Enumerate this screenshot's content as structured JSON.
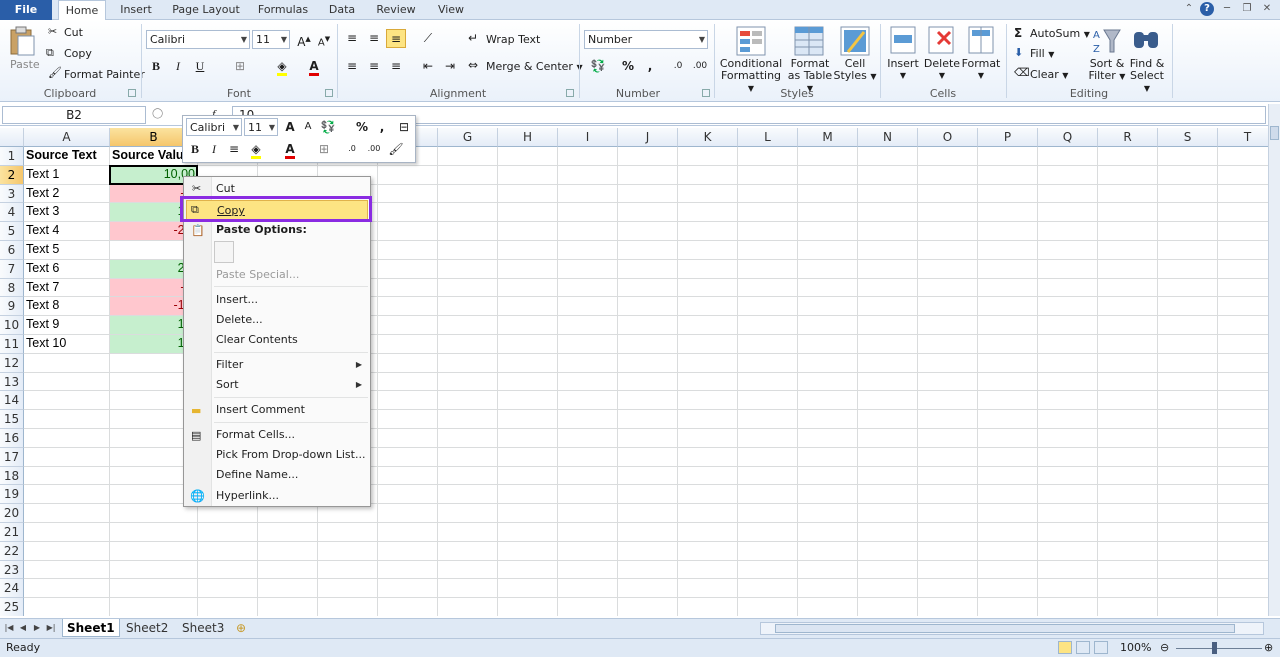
{
  "tabs": [
    "File",
    "Home",
    "Insert",
    "Page Layout",
    "Formulas",
    "Data",
    "Review",
    "View"
  ],
  "ribbon": {
    "clipboard": {
      "paste": "Paste",
      "cut": "Cut",
      "copy": "Copy",
      "format_painter": "Format Painter",
      "label": "Clipboard"
    },
    "font": {
      "name": "Calibri",
      "size": "11",
      "label": "Font"
    },
    "alignment": {
      "wrap_text": "Wrap Text",
      "merge_center": "Merge & Center",
      "label": "Alignment"
    },
    "number": {
      "format": "Number",
      "label": "Number"
    },
    "styles": {
      "conditional": [
        "Conditional",
        "Formatting"
      ],
      "format_table": [
        "Format",
        "as Table"
      ],
      "cell_styles": [
        "Cell",
        "Styles"
      ],
      "label": "Styles"
    },
    "cells": {
      "insert": "Insert",
      "delete": "Delete",
      "format": "Format",
      "label": "Cells"
    },
    "editing": {
      "autosum": "AutoSum",
      "fill": "Fill",
      "clear": "Clear",
      "sort": [
        "Sort &",
        "Filter"
      ],
      "find": [
        "Find &",
        "Select"
      ],
      "label": "Editing"
    }
  },
  "formula_bar": {
    "name_box": "B2",
    "value": "10"
  },
  "grid": {
    "columns": [
      "A",
      "B",
      "C",
      "D",
      "E",
      "F",
      "G",
      "H",
      "I",
      "J",
      "K",
      "L",
      "M",
      "N",
      "O",
      "P",
      "Q",
      "R",
      "S",
      "T"
    ],
    "rows": [
      "1",
      "2",
      "3",
      "4",
      "5",
      "6",
      "7",
      "8",
      "9",
      "10",
      "11",
      "12",
      "13",
      "14",
      "15",
      "16",
      "17",
      "18",
      "19",
      "20",
      "21",
      "22",
      "23",
      "24",
      "25"
    ],
    "headers": {
      "a1": "Source Text",
      "b1": "Source Value"
    },
    "data": [
      {
        "text": "Text 1",
        "value": "10,00",
        "sign": "pos"
      },
      {
        "text": "Text 2",
        "value": "-5,",
        "sign": "neg"
      },
      {
        "text": "Text 3",
        "value": "16,",
        "sign": "pos"
      },
      {
        "text": "Text 4",
        "value": "-27,",
        "sign": "neg"
      },
      {
        "text": "Text 5",
        "value": "0,",
        "sign": "none"
      },
      {
        "text": "Text 6",
        "value": "23,",
        "sign": "pos"
      },
      {
        "text": "Text 7",
        "value": "-6,",
        "sign": "neg"
      },
      {
        "text": "Text 8",
        "value": "-15,",
        "sign": "neg"
      },
      {
        "text": "Text 9",
        "value": "17,",
        "sign": "pos"
      },
      {
        "text": "Text 10",
        "value": "19,",
        "sign": "pos"
      }
    ]
  },
  "minibar": {
    "font": "Calibri",
    "size": "11",
    "percent": "%",
    "comma": ","
  },
  "context_menu": {
    "cut": "Cut",
    "copy": "Copy",
    "paste_options": "Paste Options:",
    "paste_special": "Paste Special...",
    "insert": "Insert...",
    "delete": "Delete...",
    "clear_contents": "Clear Contents",
    "filter": "Filter",
    "sort": "Sort",
    "insert_comment": "Insert Comment",
    "format_cells": "Format Cells...",
    "pick_dropdown": "Pick From Drop-down List...",
    "define_name": "Define Name...",
    "hyperlink": "Hyperlink..."
  },
  "sheets": [
    "Sheet1",
    "Sheet2",
    "Sheet3"
  ],
  "status": {
    "ready": "Ready",
    "zoom": "100%"
  },
  "colors": {
    "highlight_border": "#8a2be2",
    "positive_fill": "#c6efce",
    "negative_fill": "#ffc7ce",
    "selected_header": "#f5c66c"
  }
}
